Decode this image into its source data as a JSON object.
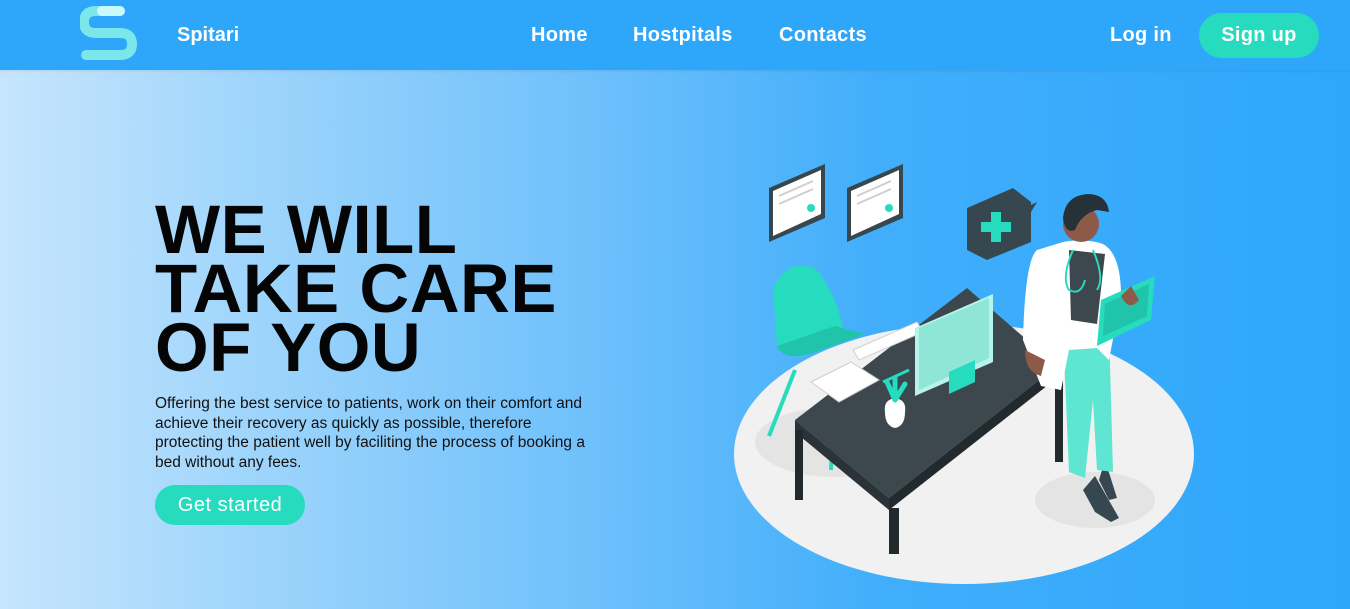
{
  "brand": {
    "name": "Spitari"
  },
  "nav": {
    "links": [
      {
        "label": "Home"
      },
      {
        "label": "Hostpitals"
      },
      {
        "label": "Contacts"
      }
    ],
    "login_label": "Log in",
    "signup_label": "Sign up"
  },
  "hero": {
    "headline": [
      "WE WILL",
      "TAKE CARE",
      "OF YOU"
    ],
    "description": "Offering the best service to patients, work on their comfort and achieve their recovery as quickly as possible, therefore protecting the patient well by faciliting the process of booking a bed without any fees.",
    "cta_label": "Get started"
  },
  "icons": {
    "logo": "s-letter-logo",
    "illustration": "doctor-at-desk-illustration"
  },
  "colors": {
    "primary": "#2ea7fb",
    "accent": "#26dbbe",
    "text_dark": "#050505",
    "white": "#ffffff"
  }
}
